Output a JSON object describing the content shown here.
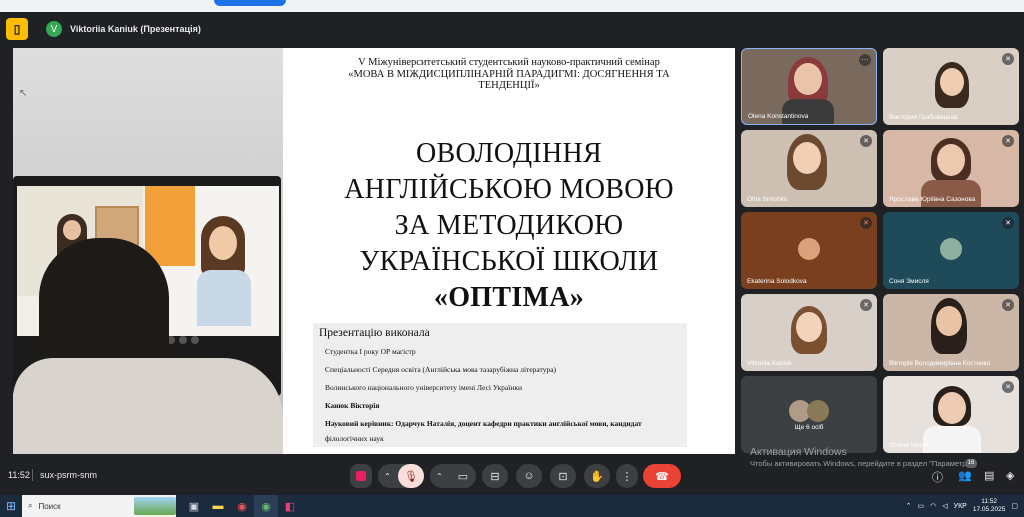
{
  "presenter": {
    "avatar_letter": "V",
    "name": "Viktoriia Kaniuk (Презентація)"
  },
  "slide": {
    "seminar_line1": "V Міжуніверситетський студентський науково-практичний семінар",
    "seminar_line2": "«МОВА В МІЖДИСЦИПЛІНАРНІЙ ПАРАДИГМІ: ДОСЯГНЕННЯ ТА",
    "seminar_line3": "ТЕНДЕНЦІЇ»",
    "title_line1": "ОВОЛОДІННЯ",
    "title_line2": "АНГЛІЙСЬКОЮ МОВОЮ",
    "title_line3": "ЗА МЕТОДИКОЮ",
    "title_line4": "УКРАЇНСЬКОЇ ШКОЛИ",
    "title_line5": "«ОПТІМА»",
    "info_heading": "Презентацію виконала",
    "info_line1": "Студентка I року ОР магістр",
    "info_line2": "Спеціальності Середня освіта (Англійська мова тазарубіжна література)",
    "info_line3": "Волинського національного університету імені Лесі Українки",
    "info_line4": "Канюк Вікторія",
    "info_line5": "Науковий керівник: Одарчук Наталія, доцент кафедри практики англійської мови, кандидат",
    "info_line6": "філологічних наук"
  },
  "participants": [
    {
      "name": "Olena Konstantinova",
      "mic": "more"
    },
    {
      "name": "Виктория Грабовецкая",
      "mic": "muted"
    },
    {
      "name": "Olha Smishko",
      "mic": "muted"
    },
    {
      "name": "Ярослава Юріївна Сазонова",
      "mic": "muted"
    },
    {
      "name": "Ekaterina Solodkova",
      "mic": "muted-red"
    },
    {
      "name": "Соня Змисля",
      "mic": "muted"
    },
    {
      "name": "Viktoriia Kaniuk",
      "mic": "muted"
    },
    {
      "name": "Вікторія Володимирівна Костенко",
      "mic": "muted"
    },
    {
      "name": "Ще 6 осіб",
      "mic": ""
    },
    {
      "name": "Олена Чухно",
      "mic": "muted"
    }
  ],
  "bottom": {
    "time": "11:52",
    "meeting_code": "sux-psrm-snm",
    "people_count": "16"
  },
  "watermark": {
    "line1": "Активация Windows",
    "line2": "Чтобы активировать Windows, перейдите в раздел \"Параметры\"."
  },
  "taskbar": {
    "search_placeholder": "Поиск",
    "lang": "УКР",
    "clock_time": "11:52",
    "clock_date": "17.05.2025"
  }
}
